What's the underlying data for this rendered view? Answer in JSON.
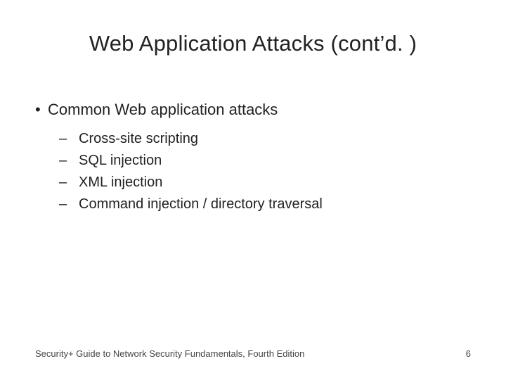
{
  "title": "Web Application Attacks (cont’d. )",
  "bullets": [
    {
      "text": "Common Web application attacks",
      "subitems": [
        "Cross-site scripting",
        "SQL injection",
        "XML injection",
        "Command injection / directory traversal"
      ]
    }
  ],
  "footer": {
    "left": "Security+ Guide to Network Security Fundamentals, Fourth Edition",
    "page": "6"
  }
}
